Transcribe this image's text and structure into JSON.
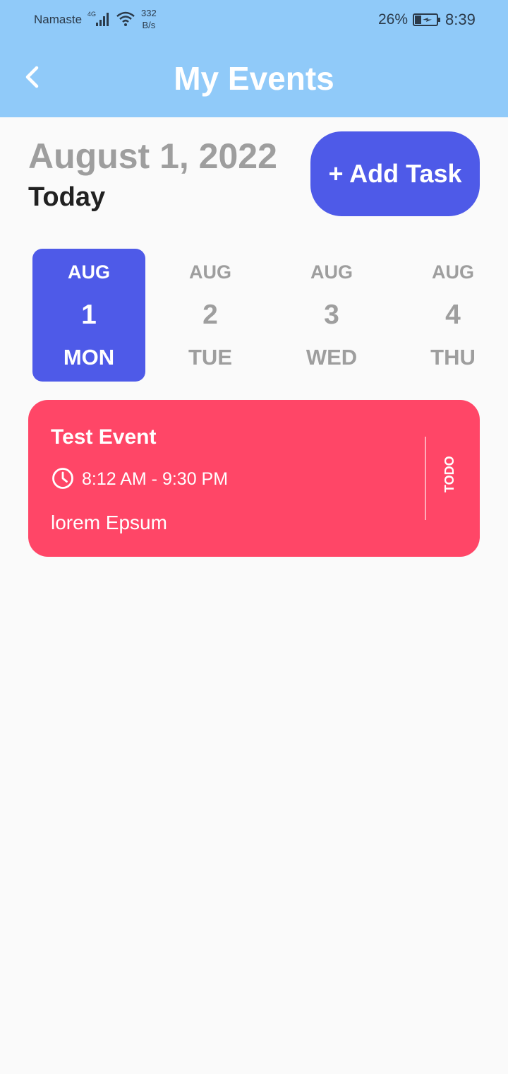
{
  "status_bar": {
    "carrier": "Namaste",
    "network_type": "4G",
    "speed_value": "332",
    "speed_unit": "B/s",
    "battery_percent": "26%",
    "time": "8:39"
  },
  "app_bar": {
    "title": "My Events",
    "back_icon": "chevron-left-icon"
  },
  "header": {
    "date": "August 1, 2022",
    "label": "Today",
    "add_button_label": "+ Add Task"
  },
  "date_picker": {
    "selected_index": 0,
    "days": [
      {
        "month": "AUG",
        "day": "1",
        "weekday": "MON"
      },
      {
        "month": "AUG",
        "day": "2",
        "weekday": "TUE"
      },
      {
        "month": "AUG",
        "day": "3",
        "weekday": "WED"
      },
      {
        "month": "AUG",
        "day": "4",
        "weekday": "THU"
      }
    ]
  },
  "events": [
    {
      "title": "Test Event",
      "time": "8:12 AM - 9:30 PM",
      "description": "lorem Epsum",
      "status": "TODO",
      "color": "#ff4667"
    }
  ],
  "colors": {
    "app_bar": "#90caf9",
    "accent": "#4e5ae8",
    "event": "#ff4667",
    "muted_text": "#9e9e9e"
  }
}
